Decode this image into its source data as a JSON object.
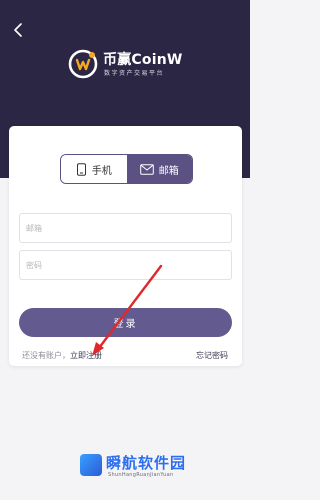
{
  "brand": {
    "name": "币赢CoinW",
    "tagline": "数字资产交易平台"
  },
  "tabs": [
    {
      "label": "手机",
      "icon": "phone-icon",
      "active": false
    },
    {
      "label": "邮箱",
      "icon": "mail-icon",
      "active": true
    }
  ],
  "form": {
    "email_placeholder": "邮箱",
    "password_placeholder": "密码",
    "login_label": "登录"
  },
  "links": {
    "no_account": "还没有账户，",
    "register": "立即注册",
    "forgot_password": "忘记密码"
  },
  "watermark": {
    "title": "瞬航软件园",
    "subtitle": "ShunHangRuanJianYuan"
  },
  "colors": {
    "header_bg": "#2b2644",
    "accent": "#5b5283",
    "button": "#635a8f",
    "annotation_arrow": "#e0282c"
  }
}
